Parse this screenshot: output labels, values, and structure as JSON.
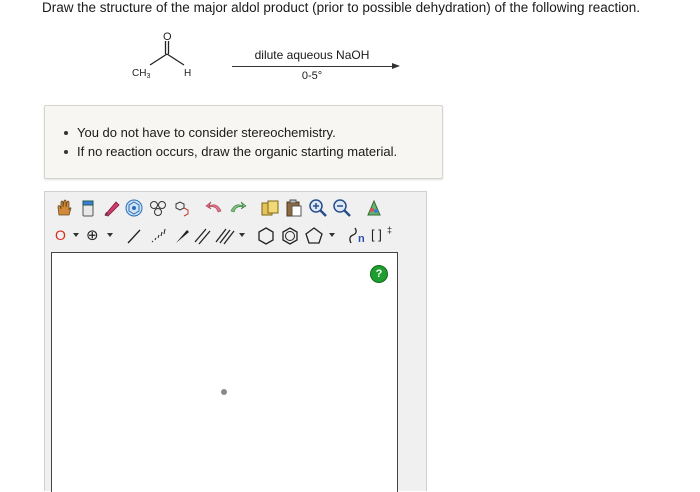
{
  "question": "Draw the structure of the major aldol product (prior to possible dehydration) of the following reaction.",
  "reactant": {
    "o_label": "O",
    "ch3_label": "CH",
    "ch3_sub": "3",
    "h_label": "H"
  },
  "conditions": {
    "reagent": "dilute aqueous NaOH",
    "temperature": "0-5°"
  },
  "notes": [
    "You do not have to consider stereochemistry.",
    "If no reaction occurs, draw the organic starting material."
  ],
  "editor": {
    "atom_label": "O",
    "charge_label": "⊕",
    "sgroup_label": "n",
    "bracket_label": "[ ]",
    "bracket_sup": "‡",
    "help_label": "?"
  }
}
